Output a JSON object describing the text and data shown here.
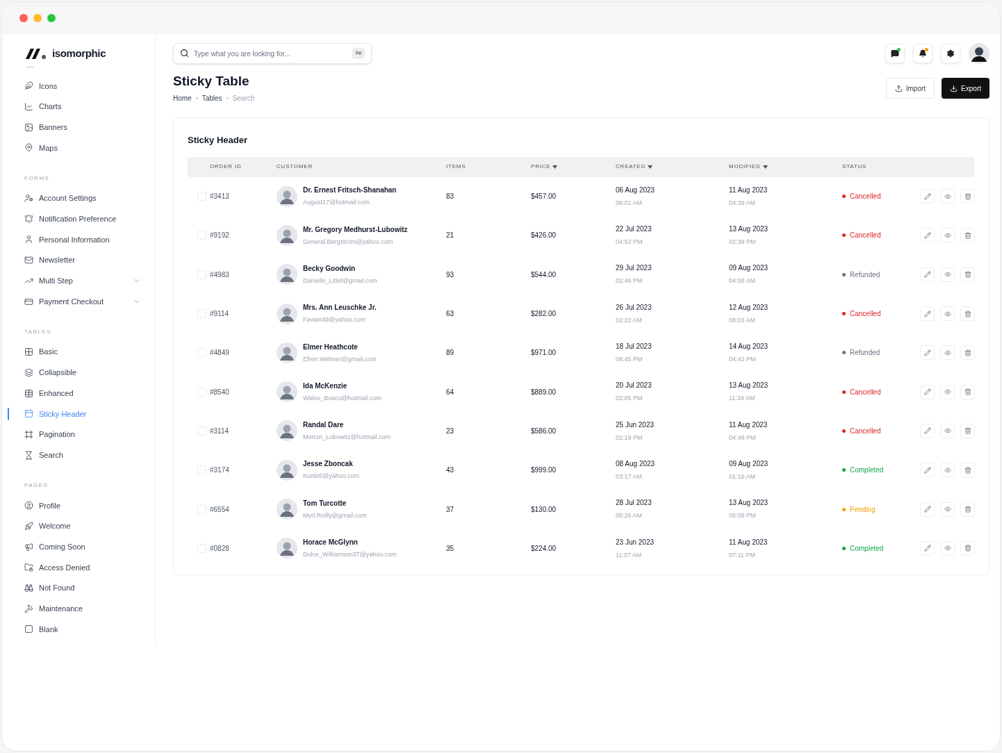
{
  "logo": {
    "text": "isomorphic"
  },
  "sidebar": {
    "sections": [
      {
        "items": [
          {
            "label": "Icons",
            "selected": false,
            "has_submenu": false
          },
          {
            "label": "Charts",
            "selected": false,
            "has_submenu": false
          },
          {
            "label": "Banners",
            "selected": false,
            "has_submenu": false
          },
          {
            "label": "Maps",
            "selected": false,
            "has_submenu": false
          }
        ]
      },
      {
        "title": "FORMS",
        "items": [
          {
            "label": "Account Settings",
            "selected": false,
            "has_submenu": false
          },
          {
            "label": "Notification Preference",
            "selected": false,
            "has_submenu": false
          },
          {
            "label": "Personal Information",
            "selected": false,
            "has_submenu": false
          },
          {
            "label": "Newsletter",
            "selected": false,
            "has_submenu": false
          },
          {
            "label": "Multi Step",
            "selected": false,
            "has_submenu": true
          },
          {
            "label": "Payment Checkout",
            "selected": false,
            "has_submenu": true
          }
        ]
      },
      {
        "title": "TABLES",
        "items": [
          {
            "label": "Basic",
            "selected": false,
            "has_submenu": false
          },
          {
            "label": "Collapsible",
            "selected": false,
            "has_submenu": false
          },
          {
            "label": "Enhanced",
            "selected": false,
            "has_submenu": false
          },
          {
            "label": "Sticky Header",
            "selected": true,
            "has_submenu": false
          },
          {
            "label": "Pagination",
            "selected": false,
            "has_submenu": false
          },
          {
            "label": "Search",
            "selected": false,
            "has_submenu": false
          }
        ]
      },
      {
        "title": "PAGES",
        "items": [
          {
            "label": "Profile",
            "selected": false,
            "has_submenu": false
          },
          {
            "label": "Welcome",
            "selected": false,
            "has_submenu": false
          },
          {
            "label": "Coming Soon",
            "selected": false,
            "has_submenu": false
          },
          {
            "label": "Access Denied",
            "selected": false,
            "has_submenu": false
          },
          {
            "label": "Not Found",
            "selected": false,
            "has_submenu": false
          },
          {
            "label": "Maintenance",
            "selected": false,
            "has_submenu": false
          },
          {
            "label": "Blank",
            "selected": false,
            "has_submenu": false
          }
        ]
      }
    ]
  },
  "search": {
    "placeholder": "Type what you are looking for...",
    "shortcut": "⌘K"
  },
  "header_icons": [
    {
      "kind": "messages",
      "color": "#22c55e"
    },
    {
      "kind": "bell",
      "color": "#f59e0b"
    },
    {
      "kind": "settings"
    }
  ],
  "page": {
    "title": "Sticky Table",
    "breadcrumbs": [
      "Home",
      "Tables",
      "Search"
    ],
    "buttons": [
      {
        "label": "Import",
        "kind": "outline"
      },
      {
        "label": "Export",
        "kind": "solid"
      }
    ]
  },
  "table": {
    "title": "Sticky Header",
    "columns": [
      {
        "label": "ORDER ID",
        "sortable": false
      },
      {
        "label": "CUSTOMER",
        "sortable": false
      },
      {
        "label": "ITEMS",
        "sortable": false
      },
      {
        "label": "PRICE",
        "sortable": true
      },
      {
        "label": "CREATED",
        "sortable": true
      },
      {
        "label": "MODIFIED",
        "sortable": true
      },
      {
        "label": "STATUS",
        "sortable": false
      }
    ],
    "rows": [
      {
        "checked": false,
        "id": "#3413",
        "name": "Dr. Ernest Fritsch-Shanahan",
        "email": "August17@hotmail.com",
        "items": "83",
        "price": "$457.00",
        "created_date": "06 Aug 2023",
        "created_time": "06:01 AM",
        "modified_date": "11 Aug 2023",
        "modified_time": "04:39 AM",
        "status": "Cancelled",
        "color": "#dc2626"
      },
      {
        "checked": false,
        "id": "#9192",
        "name": "Mr. Gregory Medhurst-Lubowitz",
        "email": "General.Bergstrom@yahoo.com",
        "items": "21",
        "price": "$426.00",
        "created_date": "22 Jul 2023",
        "created_time": "04:53 PM",
        "modified_date": "13 Aug 2023",
        "modified_time": "02:39 PM",
        "status": "Cancelled",
        "color": "#dc2626"
      },
      {
        "checked": false,
        "id": "#4983",
        "name": "Becky Goodwin",
        "email": "Danielle_Littel@gmail.com",
        "items": "93",
        "price": "$544.00",
        "created_date": "29 Jul 2023",
        "created_time": "02:46 PM",
        "modified_date": "09 Aug 2023",
        "modified_time": "04:08 AM",
        "status": "Refunded",
        "color": "#6b7280"
      },
      {
        "checked": false,
        "id": "#9114",
        "name": "Mrs. Ann Leuschke Jr.",
        "email": "Favian49@yahoo.com",
        "items": "63",
        "price": "$282.00",
        "created_date": "26 Jul 2023",
        "created_time": "02:22 AM",
        "modified_date": "12 Aug 2023",
        "modified_time": "08:03 AM",
        "status": "Cancelled",
        "color": "#dc2626"
      },
      {
        "checked": false,
        "id": "#4849",
        "name": "Elmer Heathcote",
        "email": "Efren.Wehner@gmail.com",
        "items": "89",
        "price": "$971.00",
        "created_date": "18 Jul 2023",
        "created_time": "08:45 PM",
        "modified_date": "14 Aug 2023",
        "modified_time": "04:42 PM",
        "status": "Refunded",
        "color": "#6b7280"
      },
      {
        "checked": false,
        "id": "#8540",
        "name": "Ida McKenzie",
        "email": "Waino_Bosco@hotmail.com",
        "items": "64",
        "price": "$889.00",
        "created_date": "20 Jul 2023",
        "created_time": "02:05 PM",
        "modified_date": "13 Aug 2023",
        "modified_time": "11:34 AM",
        "status": "Cancelled",
        "color": "#dc2626"
      },
      {
        "checked": false,
        "id": "#3114",
        "name": "Randal Dare",
        "email": "Morton_Lubowitz@hotmail.com",
        "items": "23",
        "price": "$586.00",
        "created_date": "25 Jun 2023",
        "created_time": "02:19 PM",
        "modified_date": "11 Aug 2023",
        "modified_time": "04:48 PM",
        "status": "Cancelled",
        "color": "#dc2626"
      },
      {
        "checked": false,
        "id": "#3174",
        "name": "Jesse Zboncak",
        "email": "Kurtis5@yahoo.com",
        "items": "43",
        "price": "$999.00",
        "created_date": "08 Aug 2023",
        "created_time": "03:17 AM",
        "modified_date": "09 Aug 2023",
        "modified_time": "01:18 AM",
        "status": "Completed",
        "color": "#16a34a"
      },
      {
        "checked": false,
        "id": "#6554",
        "name": "Tom Turcotte",
        "email": "Myrl.Reilly@gmail.com",
        "items": "37",
        "price": "$130.00",
        "created_date": "28 Jul 2023",
        "created_time": "05:26 AM",
        "modified_date": "13 Aug 2023",
        "modified_time": "05:09 PM",
        "status": "Pending",
        "color": "#f59e0b"
      },
      {
        "checked": false,
        "id": "#0828",
        "name": "Horace McGlynn",
        "email": "Dulce_Williamson37@yahoo.com",
        "items": "35",
        "price": "$224.00",
        "created_date": "23 Jun 2023",
        "created_time": "11:07 AM",
        "modified_date": "11 Aug 2023",
        "modified_time": "07:11 PM",
        "status": "Completed",
        "color": "#16a34a"
      }
    ]
  }
}
